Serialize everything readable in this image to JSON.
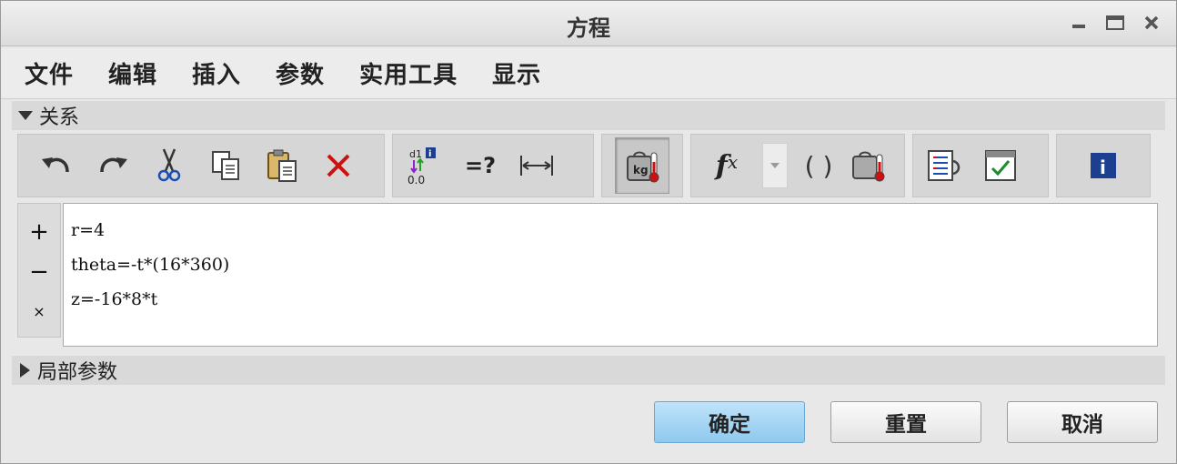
{
  "window": {
    "title": "方程",
    "controls": [
      "minimize-icon",
      "maximize-icon",
      "close-icon"
    ]
  },
  "menu": {
    "items": [
      {
        "label": "文件"
      },
      {
        "label": "编辑"
      },
      {
        "label": "插入"
      },
      {
        "label": "参数"
      },
      {
        "label": "实用工具"
      },
      {
        "label": "显示"
      }
    ]
  },
  "sections": {
    "relations": {
      "label": "关系",
      "expanded": true
    },
    "local_params": {
      "label": "局部参数",
      "expanded": false
    }
  },
  "toolbar": {
    "icons": {
      "undo": "undo-icon",
      "redo": "redo-icon",
      "cut": "cut-icon",
      "copy": "copy-icon",
      "paste": "paste-icon",
      "delete": "delete-icon",
      "switch_dims": "switch-dimensions-icon",
      "evaluate_label": "=?",
      "dimension": "dimension-icon",
      "units": "units-sensitive-icon",
      "function_label": "f",
      "function_sup": "x",
      "parentheses_label": "( )",
      "sort": "sort-relations-icon",
      "verify": "verify-relations-icon",
      "info": "info-icon",
      "info_label": "i"
    },
    "units_pressed": true
  },
  "editor": {
    "side_buttons": {
      "add": "+",
      "remove": "−",
      "clear": "×"
    },
    "lines": [
      "r=4",
      "theta=-t*(16*360)",
      "z=-16*8*t"
    ]
  },
  "buttons": {
    "ok": "确定",
    "reset": "重置",
    "cancel": "取消"
  },
  "colors": {
    "primary_button": "#8fc9ee",
    "delete_red": "#cc1111",
    "info_blue": "#1c3f8f"
  }
}
